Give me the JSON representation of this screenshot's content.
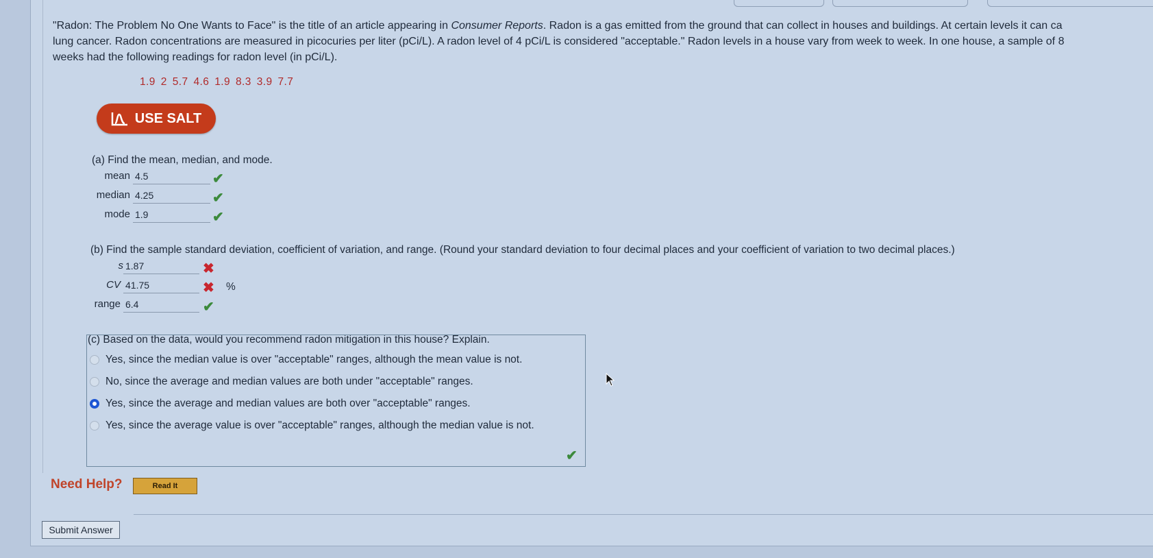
{
  "question": {
    "line1_before": "\"Radon: The Problem No One Wants to Face\" is the title of an article appearing in ",
    "line1_source": "Consumer Reports",
    "line1_after": ". Radon is a gas emitted from the ground that can collect in houses and buildings. At certain levels it can ca",
    "line2": "lung cancer. Radon concentrations are measured in picocuries per liter (pCi/L). A radon level of 4 pCi/L is considered \"acceptable.\" Radon levels in a house vary from week to week. In one house, a sample of 8",
    "line3": "weeks had the following readings for radon level (in pCi/L)."
  },
  "readings": [
    "1.9",
    "2",
    "5.7",
    "4.6",
    "1.9",
    "8.3",
    "3.9",
    "7.7"
  ],
  "salt_button": {
    "label": "USE SALT"
  },
  "part_a": {
    "prompt": "(a) Find the mean, median, and mode.",
    "fields": [
      {
        "label": "mean",
        "value": "4.5",
        "status": "correct"
      },
      {
        "label": "median",
        "value": "4.25",
        "status": "correct"
      },
      {
        "label": "mode",
        "value": "1.9",
        "status": "correct"
      }
    ]
  },
  "part_b": {
    "prompt": "(b) Find the sample standard deviation, coefficient of variation, and range. (Round your standard deviation to four decimal places and your coefficient of variation to two decimal places.)",
    "fields": [
      {
        "label": "s",
        "value": "1.87",
        "status": "incorrect",
        "unit": ""
      },
      {
        "label": "CV",
        "value": "41.75",
        "status": "incorrect",
        "unit": "%"
      },
      {
        "label": "range",
        "value": "6.4",
        "status": "correct",
        "unit": ""
      }
    ]
  },
  "part_c": {
    "prompt": "(c) Based on the data, would you recommend radon mitigation in this house? Explain.",
    "options": [
      {
        "text": "Yes, since the median value is over \"acceptable\" ranges, although the mean value is not.",
        "selected": false
      },
      {
        "text": "No, since the average and median values are both under \"acceptable\" ranges.",
        "selected": false
      },
      {
        "text": "Yes, since the average and median values are both over \"acceptable\" ranges.",
        "selected": true
      },
      {
        "text": "Yes, since the average value is over \"acceptable\" ranges, although the median value is not.",
        "selected": false
      }
    ],
    "status": "correct"
  },
  "help": {
    "label": "Need Help?",
    "read_it": "Read It"
  },
  "submit": {
    "label": "Submit Answer"
  },
  "colors": {
    "salt": "#c43b1b",
    "correct": "#3c8a3c",
    "incorrect": "#c8262e",
    "radio_selected": "#1d56d4"
  }
}
